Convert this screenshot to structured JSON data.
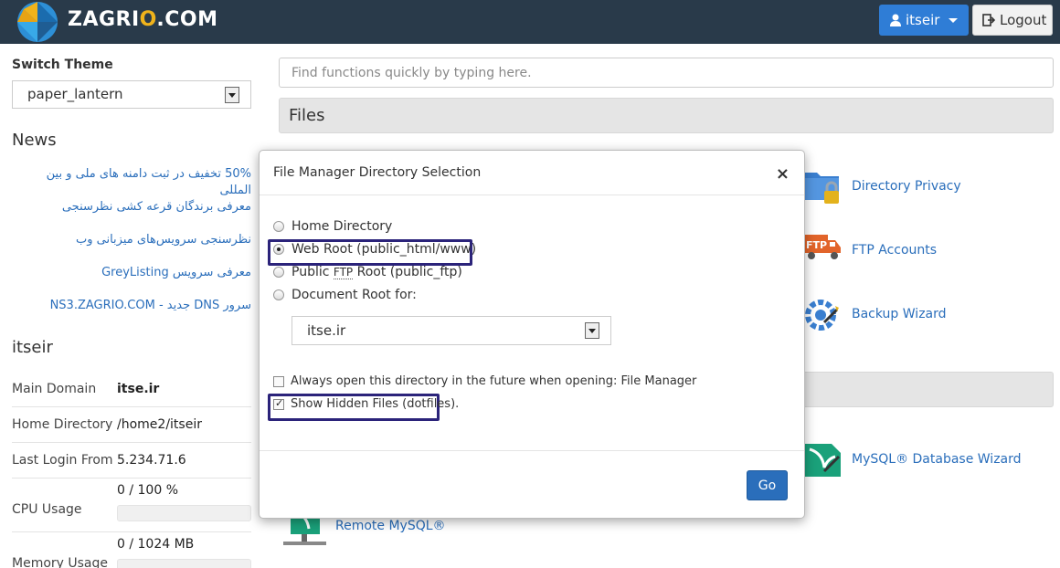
{
  "header": {
    "brand_pre": "ZAGRI",
    "brand_o": "O",
    "brand_post": ".COM",
    "user_label": "itseir",
    "logout_label": "Logout"
  },
  "sidebar": {
    "switch_theme_label": "Switch Theme",
    "theme_value": "paper_lantern",
    "news_title": "News",
    "news": [
      "50% تخفیف در ثبت دامنه های ملی و بین المللی",
      "معرفی برندگان قرعه کشی نظرسنجی",
      "نظرسنجی سرویس‌های میزبانی وب",
      "معرفی سرویس GreyListing",
      "سرور DNS جدید - NS3.ZAGRIO.COM"
    ],
    "user_title": "itseir",
    "stats": [
      {
        "label": "Main Domain",
        "value": "itse.ir"
      },
      {
        "label": "Home Directory",
        "value": "/home2/itseir"
      },
      {
        "label": "Last Login From",
        "value": "5.234.71.6"
      },
      {
        "label": "CPU Usage",
        "value": "0 / 100 %"
      },
      {
        "label": "Memory Usage",
        "value": "0 / 1024 MB"
      }
    ]
  },
  "main": {
    "search_placeholder": "Find functions quickly by typing here.",
    "files_title": "Files",
    "functions": {
      "directory_privacy": "Directory Privacy",
      "ftp_accounts": "FTP Accounts",
      "backup_wizard": "Backup Wizard",
      "mysql_wizard": "MySQL® Database Wizard",
      "remote_mysql": "Remote MySQL®"
    }
  },
  "modal": {
    "title": "File Manager  Directory Selection",
    "close": "×",
    "options": {
      "home": "Home Directory",
      "webroot": "Web Root (public_html/www)",
      "public_ftp_pre": "Public ",
      "public_ftp_abbr": "FTP",
      "public_ftp_post": " Root (public_ftp)",
      "docroot": "Document Root for:"
    },
    "domain_value": "itse.ir",
    "always_open": "Always open this directory in the future when opening: File Manager",
    "show_hidden": "Show Hidden Files (dotfiles).",
    "go": "Go"
  },
  "colors": {
    "topbar": "#293a4a",
    "accent": "#2a6ebb",
    "highlight": "#2b237a"
  }
}
